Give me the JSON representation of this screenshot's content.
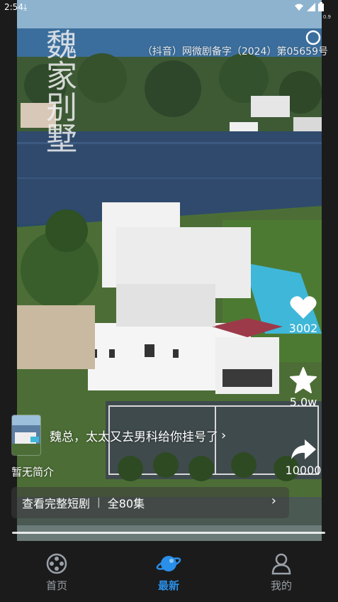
{
  "status_bar": {
    "time": "2:54",
    "download_icon": "download-icon",
    "speed": "0.9"
  },
  "video": {
    "title": "魏家别墅",
    "record_number": "（抖音）网微剧备字（2024）第05659号"
  },
  "actions": {
    "like_count": "3002",
    "favorite_count": "5.0w",
    "share_count": "10000"
  },
  "episode": {
    "title": "魏总，太太又去男科给你挂号了",
    "arrow": "›"
  },
  "intro": "暂无简介",
  "full_series": {
    "label": "查看完整短剧",
    "separator": "|",
    "episodes": "全80集",
    "chevron": "›"
  },
  "tabs": [
    {
      "label": "首页",
      "icon": "film-reel-icon"
    },
    {
      "label": "最新",
      "icon": "planet-icon"
    },
    {
      "label": "我的",
      "icon": "person-icon"
    }
  ],
  "colors": {
    "active_tab": "#2a8fe8",
    "inactive_tab": "#9aa0a8",
    "background": "#1b1b1b"
  }
}
